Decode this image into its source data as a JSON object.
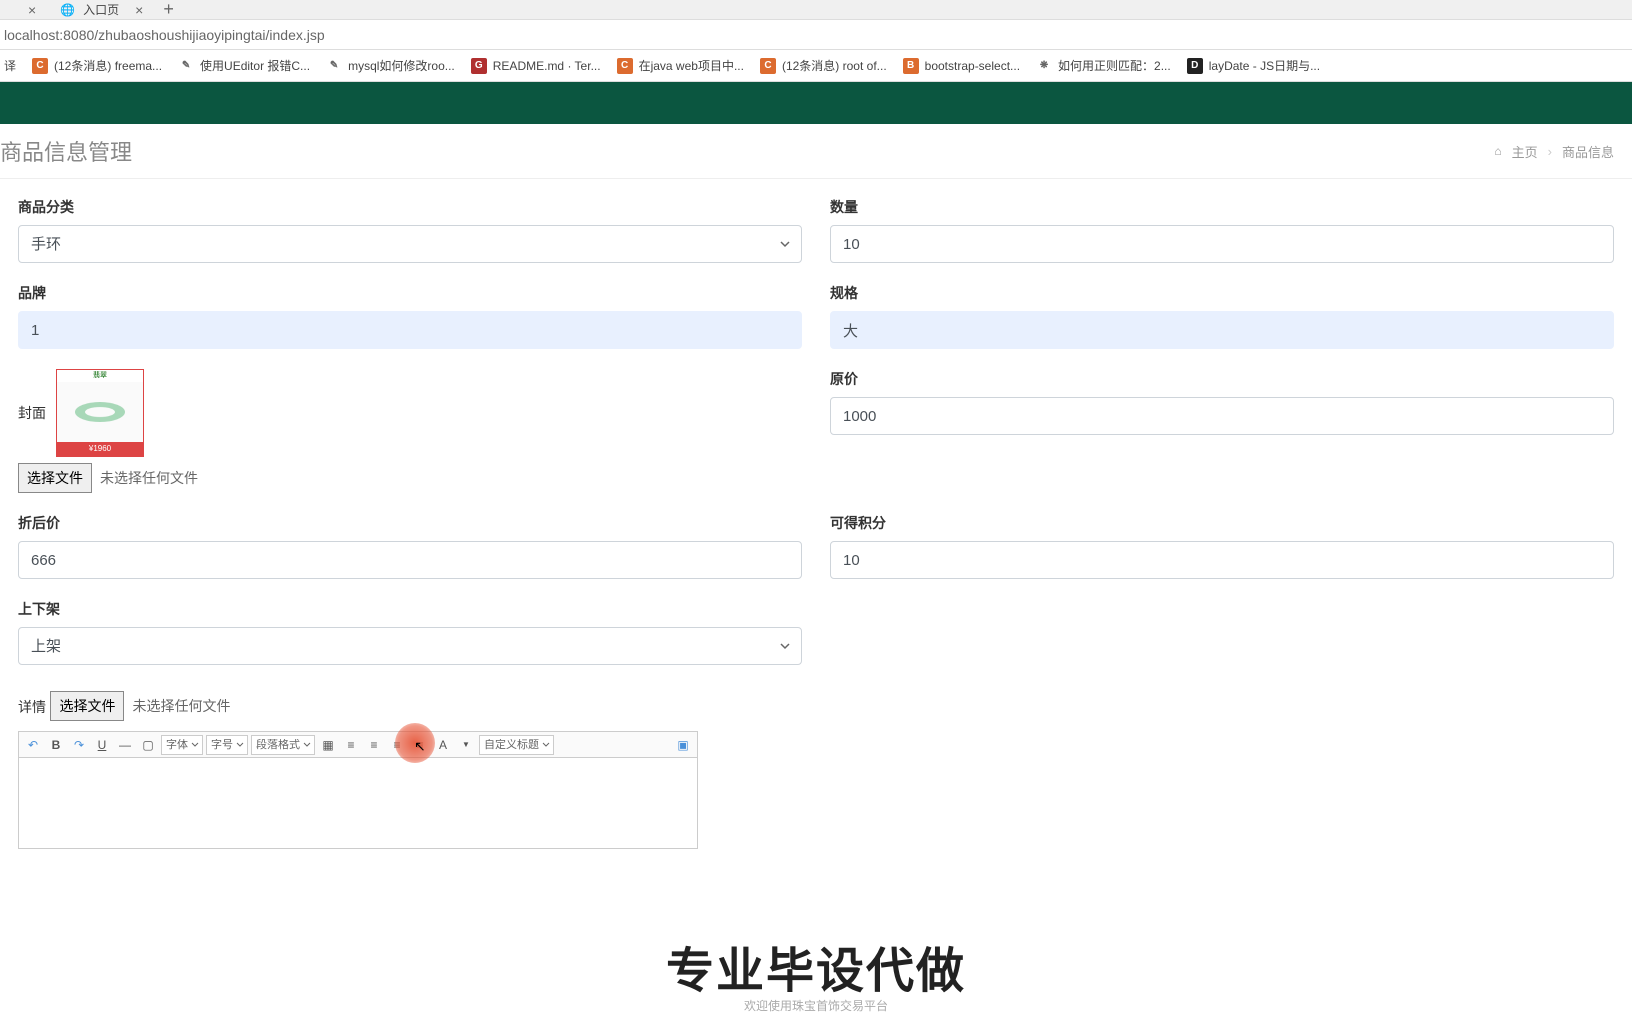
{
  "browser": {
    "tabs": [
      {
        "title": "",
        "has_close": true
      },
      {
        "title": "入口页",
        "has_close": true
      }
    ],
    "url": "localhost:8080/zhubaoshoushijiaoyipingtai/index.jsp",
    "bookmarks": [
      {
        "icon": "译",
        "label": "译"
      },
      {
        "icon": "C",
        "label": "(12条消息) freema..."
      },
      {
        "icon": "D",
        "label": "使用UEditor 报错C..."
      },
      {
        "icon": "D",
        "label": "mysql如何修改roo..."
      },
      {
        "icon": "G",
        "label": "README.md · Ter..."
      },
      {
        "icon": "C",
        "label": "在java web项目中..."
      },
      {
        "icon": "C",
        "label": "(12条消息) root of..."
      },
      {
        "icon": "B",
        "label": "bootstrap-select..."
      },
      {
        "icon": "*",
        "label": "如何用正则匹配：2..."
      },
      {
        "icon": "L",
        "label": "layDate - JS日期与..."
      }
    ]
  },
  "page": {
    "title": "商品信息管理",
    "breadcrumb_home": "主页",
    "breadcrumb_current": "商品信息"
  },
  "form": {
    "category_label": "商品分类",
    "category_value": "手环",
    "quantity_label": "数量",
    "quantity_value": "10",
    "brand_label": "品牌",
    "brand_value": "1",
    "spec_label": "规格",
    "spec_value": "大",
    "cover_label": "封面",
    "cover_price_tag": "¥1960",
    "choose_file_btn": "选择文件",
    "no_file_text": "未选择任何文件",
    "original_price_label": "原价",
    "original_price_value": "1000",
    "discount_price_label": "折后价",
    "discount_price_value": "666",
    "points_label": "可得积分",
    "points_value": "10",
    "status_label": "上下架",
    "status_value": "上架",
    "details_label": "详情"
  },
  "editor": {
    "font_family": "字体",
    "font_size": "字号",
    "paragraph": "段落格式",
    "custom_title": "自定义标题"
  },
  "watermark": {
    "big": "专业毕设代做",
    "small": "欢迎使用珠宝首饰交易平台"
  }
}
